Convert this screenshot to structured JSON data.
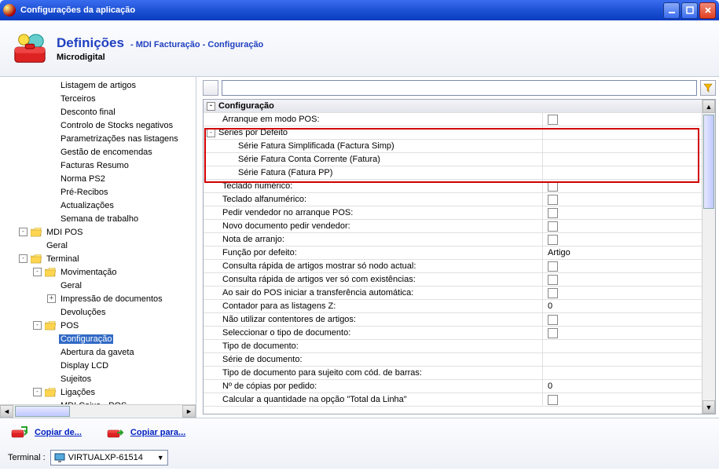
{
  "titlebar": {
    "text": "Configurações da aplicação"
  },
  "header": {
    "title": "Definições",
    "breadcrumb": "- MDI Facturação - Configuração",
    "company": "Microdigital"
  },
  "tree": {
    "items": [
      {
        "level": 3,
        "label": "Listagem de artigos"
      },
      {
        "level": 3,
        "label": "Terceiros"
      },
      {
        "level": 3,
        "label": "Desconto final"
      },
      {
        "level": 3,
        "label": "Controlo de Stocks negativos"
      },
      {
        "level": 3,
        "label": "Parametrizações nas listagens"
      },
      {
        "level": 3,
        "label": "Gestão de encomendas"
      },
      {
        "level": 3,
        "label": "Facturas Resumo"
      },
      {
        "level": 3,
        "label": "Norma PS2"
      },
      {
        "level": 3,
        "label": "Pré-Recibos"
      },
      {
        "level": 3,
        "label": "Actualizações"
      },
      {
        "level": 3,
        "label": "Semana de trabalho"
      },
      {
        "level": 1,
        "label": "MDI POS",
        "expander": "-",
        "folder": true
      },
      {
        "level": 2,
        "label": "Geral"
      },
      {
        "level": 1,
        "label": "Terminal",
        "expander": "-",
        "folder": true
      },
      {
        "level": 2,
        "label": "Movimentação",
        "expander": "-",
        "folder": true
      },
      {
        "level": 3,
        "label": "Geral"
      },
      {
        "level": 3,
        "label": "Impressão de documentos",
        "expander": "+"
      },
      {
        "level": 3,
        "label": "Devoluções"
      },
      {
        "level": 2,
        "label": "POS",
        "expander": "-",
        "folder": true
      },
      {
        "level": 3,
        "label": "Configuração",
        "selected": true
      },
      {
        "level": 3,
        "label": "Abertura da gaveta"
      },
      {
        "level": 3,
        "label": "Display LCD"
      },
      {
        "level": 3,
        "label": "Sujeitos"
      },
      {
        "level": 2,
        "label": "Ligações",
        "expander": "-",
        "folder": true
      },
      {
        "level": 3,
        "label": "MDI Caixa - POS"
      }
    ]
  },
  "grid": {
    "group": "Configuração",
    "rows": [
      {
        "label": "Arranque em modo POS:",
        "indent": 1,
        "type": "check",
        "checked": false
      },
      {
        "label": "Séries por Defeito",
        "indent": 0,
        "type": "subgroup",
        "expander": "-"
      },
      {
        "label": "Série Fatura Simplificada (Factura Simp)",
        "indent": 2,
        "type": "text",
        "value": ""
      },
      {
        "label": "Série Fatura Conta Corrente (Fatura)",
        "indent": 2,
        "type": "text",
        "value": ""
      },
      {
        "label": "Série Fatura (Fatura PP)",
        "indent": 2,
        "type": "text",
        "value": ""
      },
      {
        "label": "Teclado numérico:",
        "indent": 1,
        "type": "check",
        "checked": false
      },
      {
        "label": "Teclado alfanumérico:",
        "indent": 1,
        "type": "check",
        "checked": false
      },
      {
        "label": "Pedir vendedor no arranque POS:",
        "indent": 1,
        "type": "check",
        "checked": false
      },
      {
        "label": "Novo documento pedir vendedor:",
        "indent": 1,
        "type": "check",
        "checked": false
      },
      {
        "label": "Nota de arranjo:",
        "indent": 1,
        "type": "check",
        "checked": false
      },
      {
        "label": "Função por defeito:",
        "indent": 1,
        "type": "text",
        "value": "Artigo"
      },
      {
        "label": "Consulta rápida de artigos mostrar só nodo actual:",
        "indent": 1,
        "type": "check",
        "checked": false
      },
      {
        "label": "Consulta rápida de artigos ver só com existências:",
        "indent": 1,
        "type": "check",
        "checked": false
      },
      {
        "label": "Ao sair do POS iniciar a transferência automática:",
        "indent": 1,
        "type": "check",
        "checked": false
      },
      {
        "label": "Contador para as listagens Z:",
        "indent": 1,
        "type": "text",
        "value": "0"
      },
      {
        "label": "Não utilizar contentores de artigos:",
        "indent": 1,
        "type": "check",
        "checked": false
      },
      {
        "label": "Seleccionar o tipo de documento:",
        "indent": 1,
        "type": "check",
        "checked": false
      },
      {
        "label": "Tipo de documento:",
        "indent": 1,
        "type": "text",
        "value": ""
      },
      {
        "label": "Série de documento:",
        "indent": 1,
        "type": "text",
        "value": ""
      },
      {
        "label": "Tipo de documento para sujeito com cód. de barras:",
        "indent": 1,
        "type": "text",
        "value": ""
      },
      {
        "label": "Nº de cópias por pedido:",
        "indent": 1,
        "type": "text",
        "value": "0"
      },
      {
        "label": "Calcular a quantidade na opção \"Total da Linha\"",
        "indent": 1,
        "type": "check",
        "checked": false
      }
    ]
  },
  "footer": {
    "copy_from": "Copiar de...",
    "copy_to": "Copiar para...",
    "terminal_label": "Terminal :",
    "terminal_value": "VIRTUALXP-61514"
  }
}
